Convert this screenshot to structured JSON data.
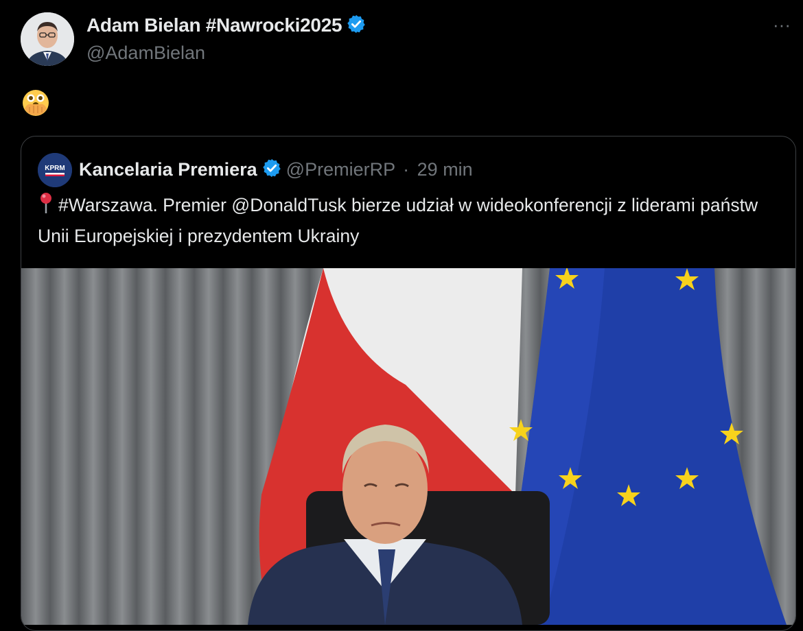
{
  "tweet": {
    "author": {
      "name": "Adam Bielan #Nawrocki2025",
      "handle": "@AdamBielan",
      "verified": true
    },
    "body_emoji": "face-with-open-eyes-and-hand-over-mouth",
    "more_label": "···"
  },
  "quoted": {
    "avatar_text": "KPRM",
    "name": "Kancelaria Premiera",
    "handle": "@PremierRP",
    "separator": "·",
    "time": "29 min",
    "verified": true,
    "text": "#Warszawa. Premier @DonaldTusk bierze udział w wideokonferencji z liderami państw Unii Europejskiej i prezydentem Ukrainy",
    "pin_icon": "round-pushpin-icon"
  },
  "colors": {
    "background": "#000000",
    "text": "#e7e9ea",
    "muted": "#71767b",
    "verified": "#1d9bf0",
    "border": "#3e4144"
  }
}
